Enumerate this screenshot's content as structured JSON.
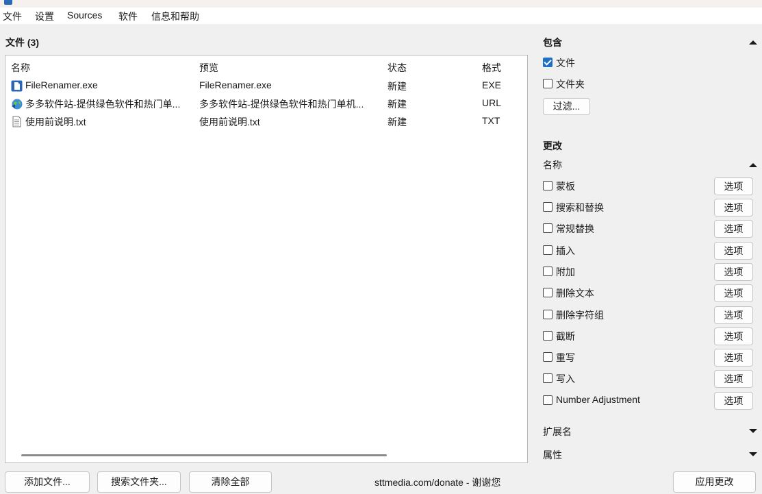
{
  "menu": [
    "文件",
    "设置",
    "Sources",
    "软件",
    "信息和帮助"
  ],
  "files_panel": {
    "title": "文件 (3)",
    "columns": [
      "名称",
      "预览",
      "状态",
      "格式"
    ],
    "rows": [
      {
        "name": "FileRenamer.exe",
        "preview": "FileRenamer.exe",
        "status": "新建",
        "format": "EXE",
        "icon": "exe-file-icon"
      },
      {
        "name": "多多软件站-提供绿色软件和热门单...",
        "preview": "多多软件站-提供绿色软件和热门单机...",
        "status": "新建",
        "format": "URL",
        "icon": "url-globe-icon"
      },
      {
        "name": "使用前说明.txt",
        "preview": "使用前说明.txt",
        "status": "新建",
        "format": "TXT",
        "icon": "text-file-icon"
      }
    ]
  },
  "bottom": {
    "add_files": "添加文件...",
    "search_folder": "搜索文件夹...",
    "clear_all": "清除全部",
    "donate": "sttmedia.com/donate - 谢谢您",
    "apply": "应用更改"
  },
  "include": {
    "title": "包含",
    "files_label": "文件",
    "files_checked": true,
    "folders_label": "文件夹",
    "folders_checked": false,
    "filter_button": "过滤..."
  },
  "changes": {
    "title": "更改",
    "name_section": "名称",
    "option_label": "选项",
    "items": [
      {
        "label": "蒙板",
        "checked": false
      },
      {
        "label": "搜索和替换",
        "checked": false
      },
      {
        "label": "常规替换",
        "checked": false
      },
      {
        "label": "插入",
        "checked": false
      },
      {
        "label": "附加",
        "checked": false
      },
      {
        "label": "删除文本",
        "checked": false
      },
      {
        "label": "删除字符组",
        "checked": false
      },
      {
        "label": "截断",
        "checked": false
      },
      {
        "label": "重写",
        "checked": false
      },
      {
        "label": "写入",
        "checked": false
      },
      {
        "label": "Number Adjustment",
        "checked": false
      }
    ],
    "extension_section": "扩展名",
    "attributes_section": "属性"
  },
  "colors": {
    "accent": "#1f6fc5",
    "background": "#f0f0f0"
  }
}
